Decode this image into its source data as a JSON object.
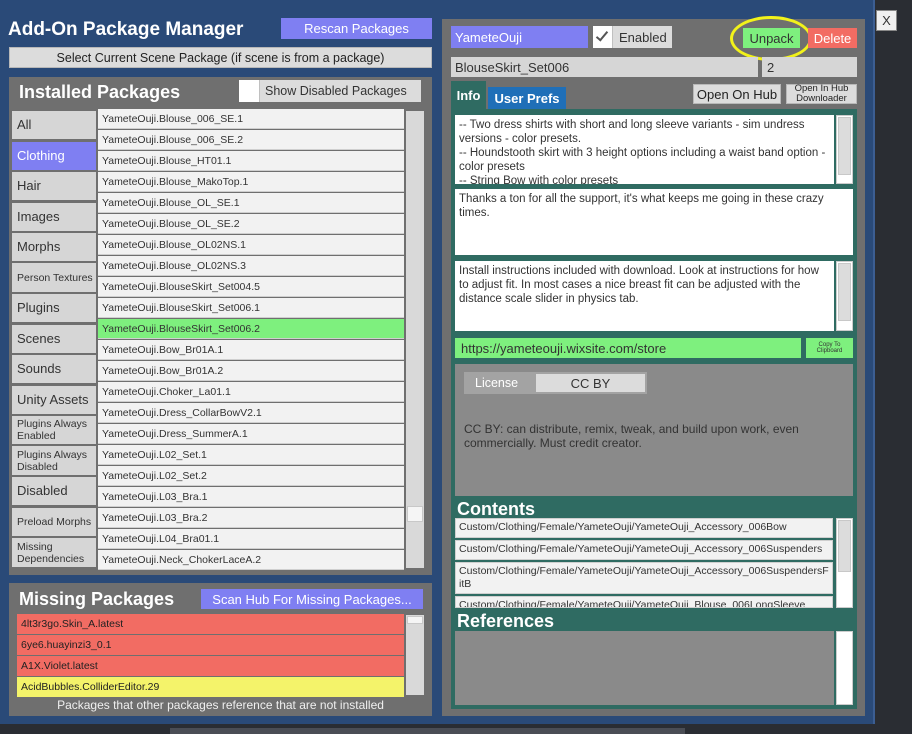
{
  "window": {
    "title": "Add-On Package Manager",
    "rescan_label": "Rescan Packages",
    "select_scene_label": "Select Current Scene Package (if scene is from a package)",
    "close_label": "X"
  },
  "installed": {
    "title": "Installed Packages",
    "show_disabled_label": "Show Disabled Packages",
    "categories": [
      {
        "label": "All"
      },
      {
        "label": "Clothing"
      },
      {
        "label": "Hair"
      },
      {
        "label": "Images"
      },
      {
        "label": "Morphs"
      },
      {
        "label": "Person Textures"
      },
      {
        "label": "Plugins"
      },
      {
        "label": "Scenes"
      },
      {
        "label": "Sounds"
      },
      {
        "label": "Unity Assets"
      },
      {
        "label": "Plugins Always Enabled"
      },
      {
        "label": "Plugins Always Disabled"
      },
      {
        "label": "Disabled"
      },
      {
        "label": "Preload Morphs"
      },
      {
        "label": "Missing Dependencies"
      }
    ],
    "selected_category": "Clothing",
    "packages": [
      "YameteOuji.Blouse_006_SE.1",
      "YameteOuji.Blouse_006_SE.2",
      "YameteOuji.Blouse_HT01.1",
      "YameteOuji.Blouse_MakoTop.1",
      "YameteOuji.Blouse_OL_SE.1",
      "YameteOuji.Blouse_OL_SE.2",
      "YameteOuji.Blouse_OL02NS.1",
      "YameteOuji.Blouse_OL02NS.3",
      "YameteOuji.BlouseSkirt_Set004.5",
      "YameteOuji.BlouseSkirt_Set006.1",
      "YameteOuji.BlouseSkirt_Set006.2",
      "YameteOuji.Bow_Br01A.1",
      "YameteOuji.Bow_Br01A.2",
      "YameteOuji.Choker_La01.1",
      "YameteOuji.Dress_CollarBowV2.1",
      "YameteOuji.Dress_SummerA.1",
      "YameteOuji.L02_Set.1",
      "YameteOuji.L02_Set.2",
      "YameteOuji.L03_Bra.1",
      "YameteOuji.L03_Bra.2",
      "YameteOuji.L04_Bra01.1",
      "YameteOuji.Neck_ChokerLaceA.2"
    ],
    "selected_package": "YameteOuji.BlouseSkirt_Set006.2"
  },
  "missing": {
    "title": "Missing Packages",
    "scan_label": "Scan Hub For Missing Packages...",
    "items": [
      {
        "label": "4lt3r3go.Skin_A.latest",
        "color": "#f26c63"
      },
      {
        "label": "6ye6.huayinzi3_0.1",
        "color": "#f26c63"
      },
      {
        "label": "A1X.Violet.latest",
        "color": "#f26c63"
      },
      {
        "label": "AcidBubbles.ColliderEditor.29",
        "color": "#f4f36a"
      }
    ],
    "footer": "Packages that other packages reference that are not installed"
  },
  "detail": {
    "creator": "YameteOuji",
    "enabled_label": "Enabled",
    "enabled_checked": true,
    "unpack_label": "Unpack",
    "delete_label": "Delete",
    "package_name": "BlouseSkirt_Set006",
    "version": "2",
    "tab_info": "Info",
    "tab_user_prefs": "User Prefs",
    "open_on_hub_label": "Open On Hub",
    "open_in_downloader_label": "Open In Hub Downloader",
    "description": "-- Two dress shirts with short and long sleeve variants - sim undress versions - color presets.\n-- Houndstooth skirt with 3 height options including a waist band option - color presets\n-- String Bow with color presets",
    "credits": "Thanks a ton for all the support, it's what keeps me going in these crazy times.",
    "instructions": "Install instructions included with download. Look at instructions for how to adjust fit. In most cases a nice breast fit can be adjusted with the distance scale slider in physics tab.",
    "url": "https://yameteouji.wixsite.com/store",
    "copy_label": "Copy To Clipboard",
    "license_label": "License",
    "license_value": "CC BY",
    "license_text": "CC BY: can distribute, remix, tweak, and build upon work, even commercially. Must credit creator.",
    "contents_title": "Contents",
    "contents": [
      "Custom/Clothing/Female/YameteOuji/YameteOuji_Accessory_006Bow",
      "Custom/Clothing/Female/YameteOuji/YameteOuji_Accessory_006Suspenders",
      "Custom/Clothing/Female/YameteOuji/YameteOuji_Accessory_006SuspendersFitB",
      "Custom/Clothing/Female/YameteOuji/YameteOuji_Blouse_006LongSleeve"
    ],
    "references_title": "References"
  },
  "colors": {
    "accent_purple": "#7f7ff2",
    "selected_green": "#7ef07e",
    "delete_red": "#f26c63",
    "teal_panel": "#2f6b62",
    "annotation_yellow": "#f2f21a"
  }
}
